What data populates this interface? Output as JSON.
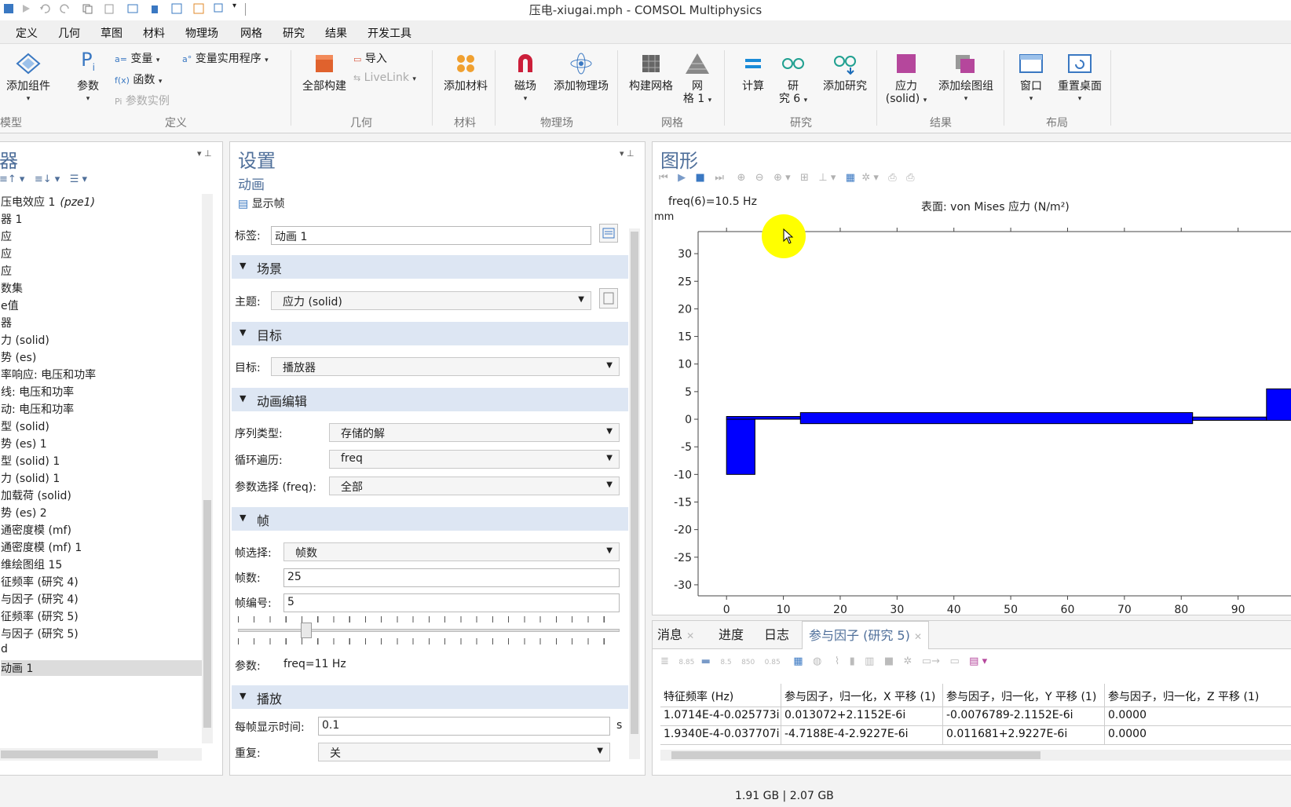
{
  "window": {
    "title": "压电-xiugai.mph - COMSOL Multiphysics"
  },
  "menu": [
    "定义",
    "几何",
    "草图",
    "材料",
    "物理场",
    "网格",
    "研究",
    "结果",
    "开发工具"
  ],
  "ribbon": {
    "add_component": "添加组件",
    "params": "参数",
    "variables": "变量",
    "functions": "函数",
    "param_instance": "参数实例",
    "var_utilities": "变量实用程序",
    "build_all": "全部构建",
    "import": "导入",
    "livelink": "LiveLink",
    "add_material": "添加材料",
    "magnetic": "磁场",
    "add_physics": "添加物理场",
    "build_mesh": "构建网格",
    "mesh1_a": "网",
    "mesh1_b": "格 1",
    "compute": "计算",
    "study6_a": "研",
    "study6_b": "究 6",
    "add_study": "添加研究",
    "stress_a": "应力",
    "stress_b": "(solid)",
    "add_plot_group": "添加绘图组",
    "window": "窗口",
    "reset_desktop": "重置桌面",
    "groups": {
      "model": "模型",
      "define": "定义",
      "geometry": "几何",
      "material": "材料",
      "physics": "物理场",
      "mesh": "网格",
      "study": "研究",
      "results": "结果",
      "layout": "布局"
    }
  },
  "tree": {
    "header": "器",
    "items": [
      {
        "text": "压电效应 1",
        "em": "(pze1)"
      },
      {
        "text": "器 1"
      },
      {
        "text": "应"
      },
      {
        "text": "应"
      },
      {
        "text": "应"
      },
      {
        "text": "数集"
      },
      {
        "text": "e值"
      },
      {
        "text": "器"
      },
      {
        "text": "力 (solid)"
      },
      {
        "text": "势 (es)"
      },
      {
        "text": "率响应: 电压和功率"
      },
      {
        "text": "线: 电压和功率"
      },
      {
        "text": "动: 电压和功率"
      },
      {
        "text": "型 (solid)"
      },
      {
        "text": "势 (es) 1"
      },
      {
        "text": "型 (solid) 1"
      },
      {
        "text": "力 (solid) 1"
      },
      {
        "text": "加载荷 (solid)"
      },
      {
        "text": "势 (es) 2"
      },
      {
        "text": "通密度模 (mf)"
      },
      {
        "text": "通密度模 (mf) 1"
      },
      {
        "text": "维绘图组 15"
      },
      {
        "text": "征频率 (研究 4)"
      },
      {
        "text": "与因子 (研究 4)"
      },
      {
        "text": "征频率 (研究 5)"
      },
      {
        "text": "与因子 (研究 5)"
      },
      {
        "text": "d"
      },
      {
        "text": "动画 1"
      }
    ]
  },
  "settings": {
    "title": "设置",
    "subtitle": "动画",
    "show_frame": "显示帧",
    "label_label": "标签:",
    "label_value": "动画 1",
    "sections": {
      "scene": "场景",
      "target": "目标",
      "anim_edit": "动画编辑",
      "frames": "帧",
      "playback": "播放"
    },
    "subject_label": "主题:",
    "subject_value": "应力 (solid)",
    "target_label": "目标:",
    "target_value": "播放器",
    "seq_type_label": "序列类型:",
    "seq_type_value": "存储的解",
    "loop_label": "循环遍历:",
    "loop_value": "freq",
    "param_sel_label": "参数选择 (freq):",
    "param_sel_value": "全部",
    "frame_sel_label": "帧选择:",
    "frame_sel_value": "帧数",
    "frame_count_label": "帧数:",
    "frame_count_value": "25",
    "frame_num_label": "帧编号:",
    "frame_num_value": "5",
    "slider_fraction": 0.17,
    "param_label": "参数:",
    "param_value": "freq=11 Hz",
    "frame_time_label": "每帧显示时间:",
    "frame_time_value": "0.1",
    "frame_time_unit": "s",
    "repeat_label": "重复:",
    "repeat_value": "关"
  },
  "graphics": {
    "title": "图形",
    "freq_text": "freq(6)=10.5 Hz",
    "surface_text": "表面: von Mises 应力 (N/m²)",
    "y_unit": "mm"
  },
  "chart_data": {
    "type": "bar",
    "xlim": [
      -5,
      100
    ],
    "ylim": [
      -32,
      34
    ],
    "x_ticks": [
      0,
      10,
      20,
      30,
      40,
      50,
      60,
      70,
      80,
      90
    ],
    "x_tick_labels": [
      "0",
      "10",
      "20",
      "30",
      "40",
      "50",
      "60",
      "70",
      "80",
      "90"
    ],
    "y_ticks": [
      30,
      25,
      20,
      15,
      10,
      5,
      0,
      -5,
      -10,
      -15,
      -20,
      -25,
      -30
    ],
    "y_tick_labels": [
      "30",
      "25",
      "20",
      "15",
      "10",
      "5",
      "0",
      "-5",
      "-10",
      "-15",
      "-20",
      "-25",
      "-30"
    ],
    "shapes": [
      {
        "name": "left-block",
        "x0": 0,
        "x1": 5,
        "y0": -10,
        "y1": 0
      },
      {
        "name": "beam-thin-left",
        "x0": 0,
        "x1": 13,
        "y0": 0,
        "y1": 0.5
      },
      {
        "name": "beam-main",
        "x0": 13,
        "x1": 82,
        "y0": -0.8,
        "y1": 1.2
      },
      {
        "name": "beam-thin-right",
        "x0": 82,
        "x1": 95,
        "y0": -0.2,
        "y1": 0.4
      },
      {
        "name": "right-block",
        "x0": 95,
        "x1": 100,
        "y0": -0.2,
        "y1": 5.5
      }
    ],
    "fill": "#0000ff"
  },
  "bottom": {
    "tabs": [
      "消息",
      "进度",
      "日志",
      "参与因子 (研究 5)"
    ],
    "columns": [
      "特征频率 (Hz)",
      "参与因子，归一化，X 平移 (1)",
      "参与因子，归一化，Y 平移 (1)",
      "参与因子，归一化，Z 平移 (1)"
    ],
    "rows": [
      [
        "1.0714E-4-0.025773i",
        "0.013072+2.1152E-6i",
        "-0.0076789-2.1152E-6i",
        "0.0000"
      ],
      [
        "1.9340E-4-0.037707i",
        "-4.7188E-4-2.9227E-6i",
        "0.011681+2.9227E-6i",
        "0.0000"
      ]
    ]
  },
  "status": {
    "memory": "1.91 GB | 2.07 GB"
  },
  "colors": {
    "accent": "#4f6f9a",
    "section_bg": "#dde6f3",
    "highlight": "#ffff00"
  }
}
